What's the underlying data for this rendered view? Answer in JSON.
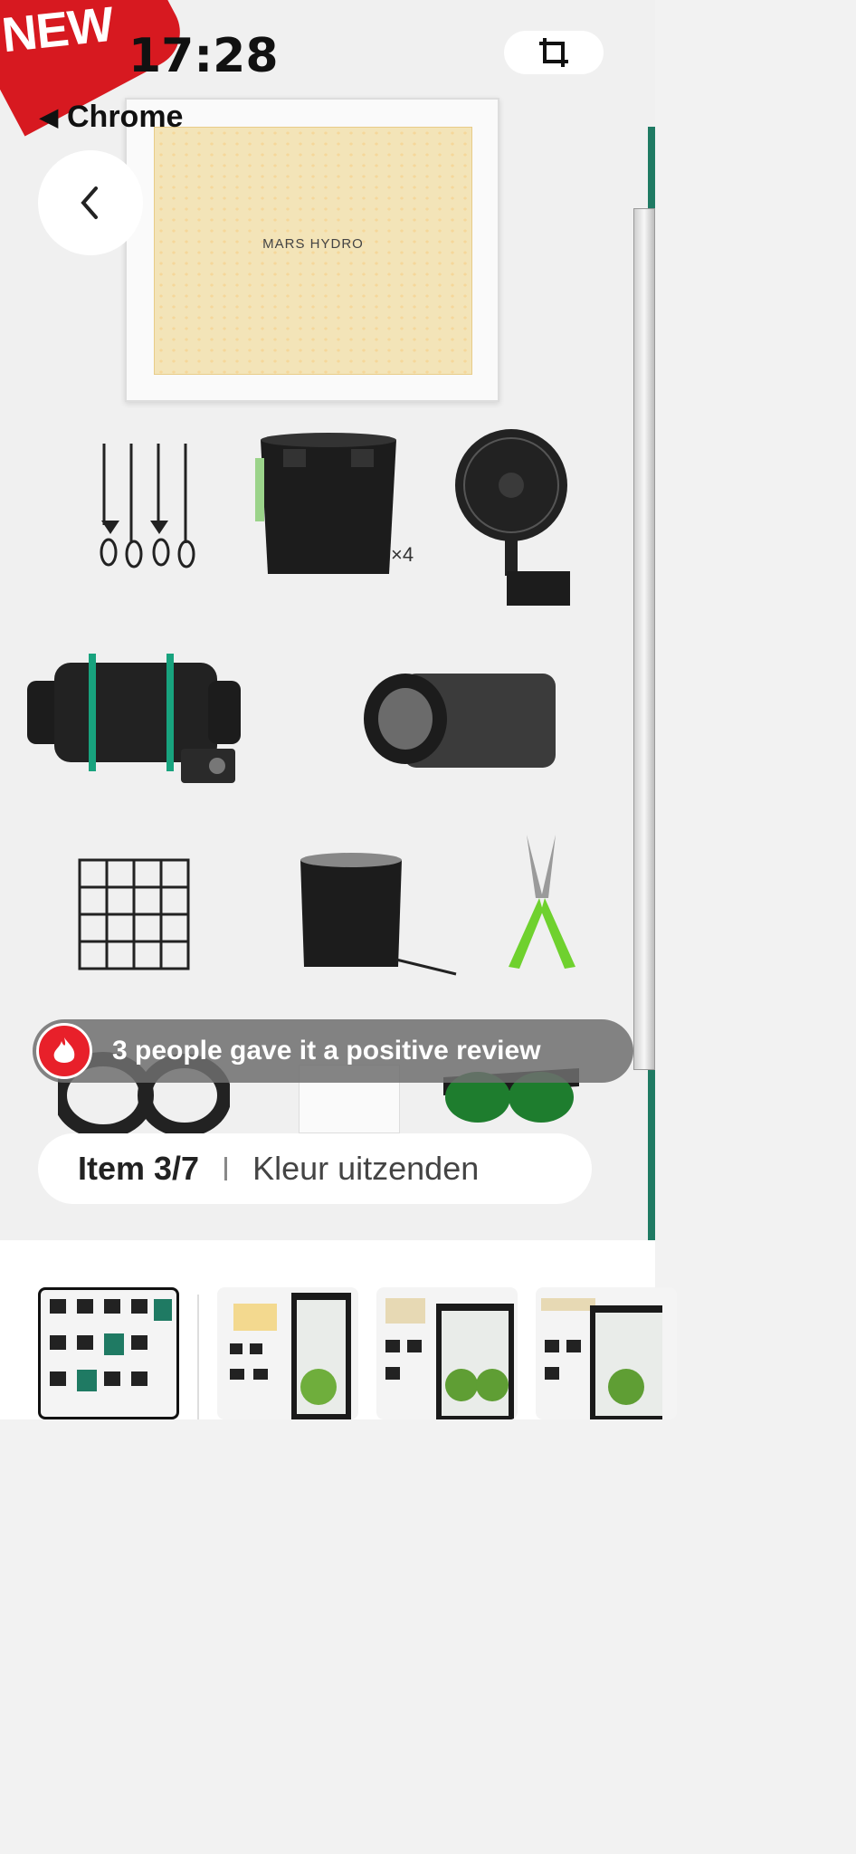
{
  "status": {
    "time": "17:28"
  },
  "nav": {
    "back_app": "Chrome"
  },
  "promo": {
    "badge": "NEW"
  },
  "product": {
    "brand_label": "MARS HYDRO",
    "pot_count": "×4"
  },
  "review": {
    "text": "3 people gave it a positive review"
  },
  "selector": {
    "item_count": "Item 3/7",
    "variant": "Kleur uitzenden"
  },
  "thumbnails": [
    {
      "name": "thumbnail-1",
      "selected": true
    },
    {
      "name": "thumbnail-2",
      "selected": false
    },
    {
      "name": "thumbnail-3",
      "selected": false
    },
    {
      "name": "thumbnail-4",
      "selected": false
    }
  ],
  "colors": {
    "accent": "#d71920",
    "tent_green": "#1f7a63",
    "pill_bg": "#ffffff"
  }
}
